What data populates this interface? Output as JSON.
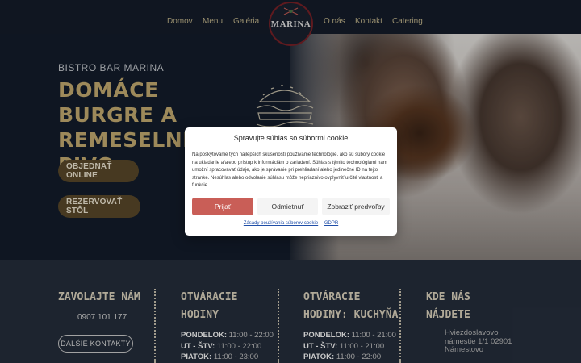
{
  "nav": {
    "items": [
      {
        "label": "Domov"
      },
      {
        "label": "Menu"
      },
      {
        "label": "Galéria"
      },
      {
        "label": "O nás"
      },
      {
        "label": "Kontakt"
      },
      {
        "label": "Catering"
      }
    ],
    "logo_text": "MARINA"
  },
  "hero": {
    "kicker": "BISTRO BAR MARINA",
    "title": "DOMÁCE BURGRE A REMESELNÉ PIVO",
    "btn_order": "OBJEDNAŤ ONLINE",
    "btn_reserve": "REZERVOVAŤ STÔL"
  },
  "info": {
    "call_title": "ZAVOLAJTE NÁM",
    "phone": "0907 101 177",
    "contacts_btn": "ĎALŠIE KONTAKTY",
    "hours_title": "OTVÁRACIE HODINY",
    "hours": [
      {
        "day": "PONDELOK:",
        "time": " 11:00 - 22:00"
      },
      {
        "day": "UT - ŠTV:",
        "time": " 11:00 - 22:00"
      },
      {
        "day": "PIATOK:",
        "time": " 11:00 - 23:00"
      }
    ],
    "kitchen_title": "OTVÁRACIE HODINY: KUCHYŇA",
    "kitchen_hours": [
      {
        "day": "PONDELOK:",
        "time": " 11:00 - 21:00"
      },
      {
        "day": "UT - ŠTV:",
        "time": " 11:00 - 21:00"
      },
      {
        "day": "PIATOK:",
        "time": " 11:00 - 22:00"
      }
    ],
    "find_title": "KDE NÁS NÁJDETE",
    "address_lines": [
      "Hviezdoslavovo",
      "námestie 1/1 02901",
      "Námestovo"
    ]
  },
  "cookie_modal": {
    "title": "Spravujte súhlas so súbormi cookie",
    "body": "Na poskytovanie tých najlepších skúseností používame technológie, ako sú súbory cookie na ukladanie a/alebo prístup k informáciám o zariadení. Súhlas s týmito technológiami nám umožní spracovávať údaje, ako je správanie pri prehliadaní alebo jedinečné ID na tejto stránke. Nesúhlas alebo odvolanie súhlasu môže nepriaznivo ovplyvniť určité vlastnosti a funkcie.",
    "accept": "Prijať",
    "deny": "Odmietnuť",
    "preferences": "Zobraziť predvoľby",
    "link_policy": "Zásady používania súborov cookie",
    "link_gdpr": "GDPR"
  },
  "colors": {
    "accent_gold": "#c9b074",
    "accept_button": "#c95e57",
    "hero_bg": "#141d2c",
    "info_bg": "#262f3d"
  }
}
